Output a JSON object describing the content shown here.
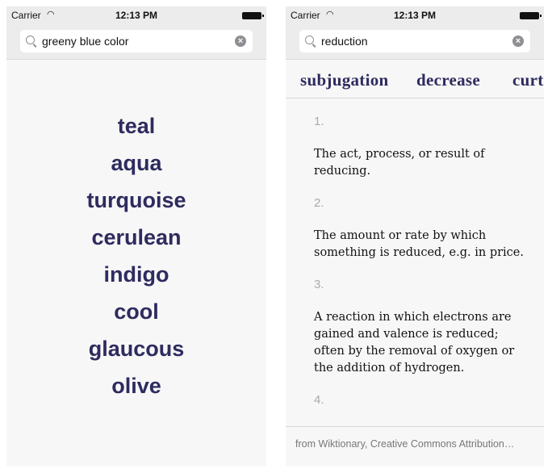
{
  "left": {
    "status": {
      "carrier": "Carrier",
      "time": "12:13 PM"
    },
    "search": {
      "value": "greeny blue color"
    },
    "results": [
      "teal",
      "aqua",
      "turquoise",
      "cerulean",
      "indigo",
      "cool",
      "glaucous",
      "olive"
    ]
  },
  "right": {
    "status": {
      "carrier": "Carrier",
      "time": "12:13 PM"
    },
    "search": {
      "value": "reduction"
    },
    "synonyms": [
      "subjugation",
      "decrease",
      "curt"
    ],
    "definitions": [
      {
        "number": "1.",
        "text": "The act, process, or result of reducing."
      },
      {
        "number": "2.",
        "text": "The amount or rate by which something is reduced, e.g. in price."
      },
      {
        "number": "3.",
        "text": "A reaction in which electrons are gained and valence is reduced; often by the removal of oxygen or the addition of hydrogen."
      },
      {
        "number": "4.",
        "text": ""
      }
    ],
    "attribution": "from Wiktionary, Creative Commons Attribution…"
  },
  "colors": {
    "accent": "#2e2b5f",
    "background": "#f7f7f7",
    "header": "#ececec"
  }
}
